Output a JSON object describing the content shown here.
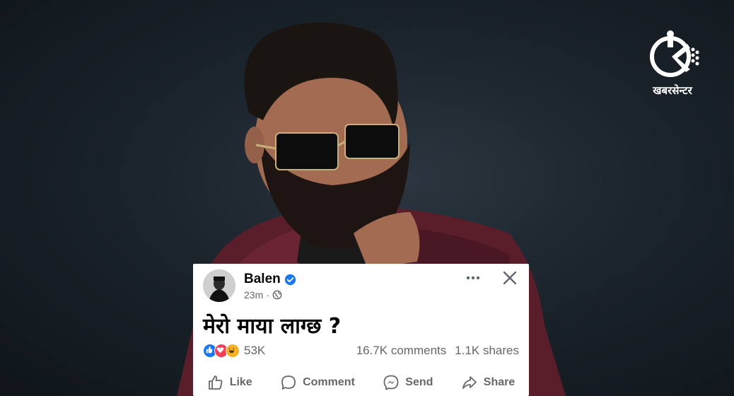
{
  "logo": {
    "text": "खबरसेन्टर",
    "icon": "khabarcenter-logo-icon"
  },
  "post": {
    "author": "Balen",
    "verified": true,
    "time": "23m",
    "separator": "·",
    "privacy_icon": "globe-icon",
    "text": "मेरो माया लाग्छ ?",
    "reactions": {
      "icons": [
        "like-reaction-icon",
        "love-reaction-icon",
        "haha-reaction-icon"
      ],
      "count": "53K"
    },
    "comments": "16.7K comments",
    "shares": "1.1K shares"
  },
  "actions": {
    "like": "Like",
    "comment": "Comment",
    "send": "Send",
    "share": "Share"
  },
  "colors": {
    "accent": "#1877f2",
    "love": "#f33e58",
    "haha": "#f7b125",
    "muted": "#65676b"
  }
}
